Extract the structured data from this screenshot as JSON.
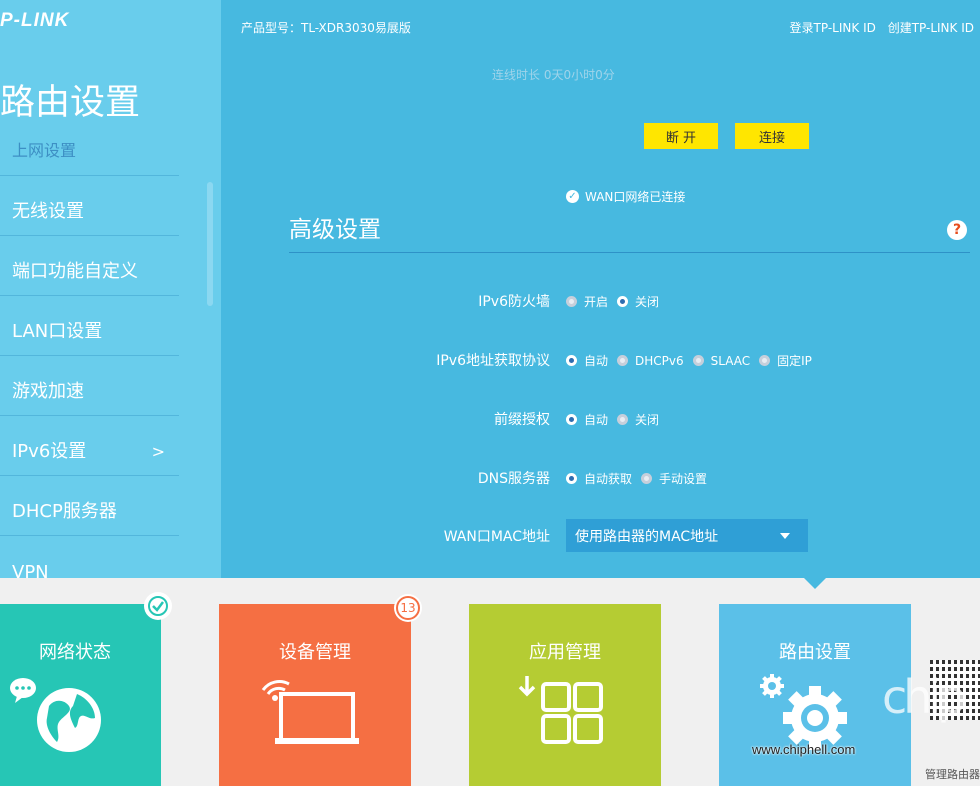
{
  "header": {
    "logo": "P-LINK",
    "model": "产品型号：TL-XDR3030易展版",
    "login": "登录TP-LINK ID",
    "create": "创建TP-LINK ID"
  },
  "sidebar": {
    "title": "路由设置",
    "items": [
      {
        "label": "上网设置"
      },
      {
        "label": "无线设置"
      },
      {
        "label": "端口功能自定义"
      },
      {
        "label": "LAN口设置"
      },
      {
        "label": "游戏加速"
      },
      {
        "label": "IPv6设置",
        "active": true,
        "chevron": ">"
      },
      {
        "label": "DHCP服务器"
      },
      {
        "label": "VPN"
      }
    ]
  },
  "main": {
    "faded_text": "连线时长    0天0小时0分",
    "disconnect_label": "断 开",
    "connect_label": "连接",
    "wan_status": "WAN口网络已连接",
    "advanced_title": "高级设置",
    "help_glyph": "?",
    "rows": {
      "firewall": {
        "label": "IPv6防火墙",
        "opts": [
          "开启",
          "关闭"
        ],
        "selected": "关闭"
      },
      "addr": {
        "label": "IPv6地址获取协议",
        "opts": [
          "自动",
          "DHCPv6",
          "SLAAC",
          "固定IP"
        ],
        "selected": "自动"
      },
      "prefix": {
        "label": "前缀授权",
        "opts": [
          "自动",
          "关闭"
        ],
        "selected": "自动"
      },
      "dns": {
        "label": "DNS服务器",
        "opts": [
          "自动获取",
          "手动设置"
        ],
        "selected": "自动获取"
      },
      "mac": {
        "label": "WAN口MAC地址",
        "value": "使用路由器的MAC地址"
      }
    }
  },
  "tiles": [
    {
      "title": "网络状态",
      "color": "#26c6b5",
      "badge": "check"
    },
    {
      "title": "设备管理",
      "color": "#f56f43",
      "badge": "13"
    },
    {
      "title": "应用管理",
      "color": "#b5cc33"
    },
    {
      "title": "路由设置",
      "color": "#5bc0e8",
      "active": true
    }
  ],
  "watermark": {
    "chip": "chip",
    "url": "www.chiphell.com",
    "bottom": "管理路由器"
  }
}
